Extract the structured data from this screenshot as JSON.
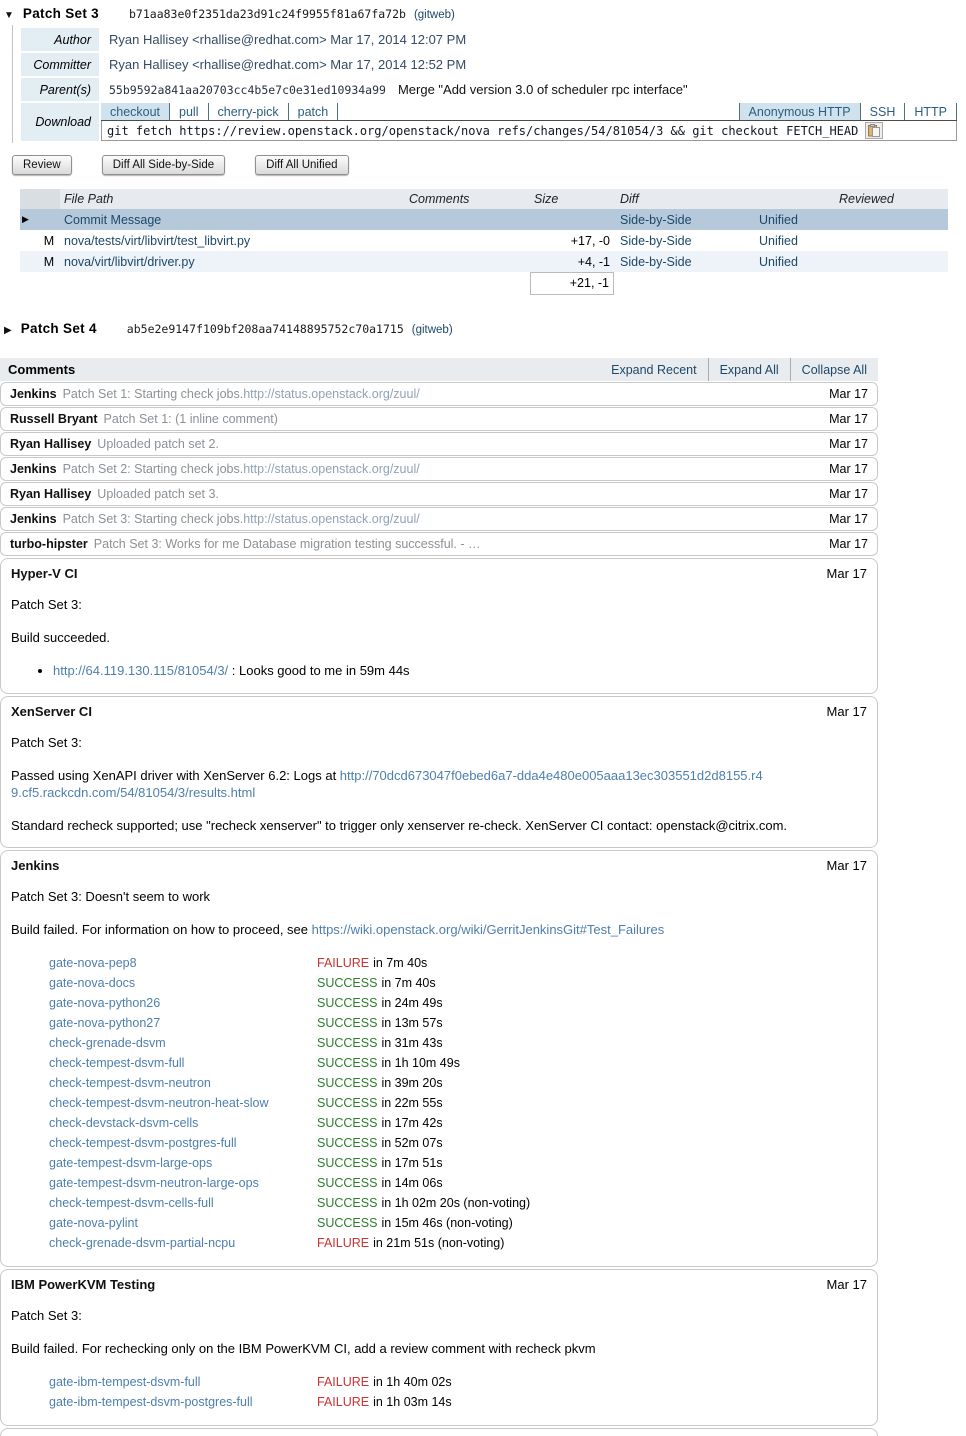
{
  "colors": {
    "success_green": "#2d7d2d",
    "failure_red": "#cc3333",
    "body_link_blue": "#4d7fae",
    "nav_link_navy": "#1d4868",
    "selected_row_bg": "#b5c9db",
    "tab_selected_bg": "#cfe2ee",
    "label_col_bg": "#e3edf4"
  },
  "icons": {
    "expanded_triangle": "▼",
    "collapsed_triangle": "▶",
    "row_pointer": "▶",
    "copy": "clipboard"
  },
  "patch_set_3": {
    "title": "Patch Set 3",
    "hash": "b71aa83e0f2351da23d91c24f9955f81a67fa72b",
    "gitweb_label": "(gitweb)",
    "info": {
      "author_label": "Author",
      "author_value": "Ryan Hallisey <rhallise@redhat.com> Mar 17, 2014 12:07 PM",
      "committer_label": "Committer",
      "committer_value": "Ryan Hallisey <rhallise@redhat.com> Mar 17, 2014 12:52 PM",
      "parents_label": "Parent(s)",
      "parents_hash": "55b9592a841aa20703cc4b5e7c0e31ed10934a99",
      "parents_subject": "Merge \"Add version 3.0 of scheduler rpc interface\"",
      "download_label": "Download",
      "scheme_tabs": [
        {
          "label": "checkout",
          "selected": true
        },
        {
          "label": "pull",
          "selected": false
        },
        {
          "label": "cherry-pick",
          "selected": false
        },
        {
          "label": "patch",
          "selected": false
        }
      ],
      "protocol_tabs": [
        {
          "label": "Anonymous HTTP",
          "selected": true
        },
        {
          "label": "SSH",
          "selected": false
        },
        {
          "label": "HTTP",
          "selected": false
        }
      ],
      "download_command": "git fetch https://review.openstack.org/openstack/nova refs/changes/54/81054/3 && git checkout FETCH_HEAD"
    },
    "buttons": [
      "Review",
      "Diff All Side-by-Side",
      "Diff All Unified"
    ],
    "file_table": {
      "headers": [
        "File Path",
        "Comments",
        "Size",
        "Diff",
        "Reviewed"
      ],
      "rows": [
        {
          "pointer": "▶",
          "status": "",
          "path": "Commit Message",
          "comments": "",
          "size": "",
          "sbs": "Side-by-Side",
          "unified": "Unified",
          "reviewed": "",
          "selected": true,
          "shade": false
        },
        {
          "pointer": "",
          "status": "M",
          "path": "nova/tests/virt/libvirt/test_libvirt.py",
          "comments": "",
          "size": "+17, -0",
          "sbs": "Side-by-Side",
          "unified": "Unified",
          "reviewed": "",
          "selected": false,
          "shade": false
        },
        {
          "pointer": "",
          "status": "M",
          "path": "nova/virt/libvirt/driver.py",
          "comments": "",
          "size": "+4, -1",
          "sbs": "Side-by-Side",
          "unified": "Unified",
          "reviewed": "",
          "selected": false,
          "shade": true
        }
      ],
      "total_size": "+21, -1"
    }
  },
  "patch_set_4": {
    "title": "Patch Set 4",
    "hash": "ab5e2e9147f109bf208aa74148895752c70a1715",
    "gitweb_label": "(gitweb)"
  },
  "comments": {
    "title": "Comments",
    "actions": [
      {
        "label": "Expand Recent",
        "first": true
      },
      {
        "label": "Expand All",
        "first": false
      },
      {
        "label": "Collapse All",
        "first": false
      }
    ],
    "collapsed": [
      {
        "author": "Jenkins",
        "summary": "Patch Set 1: Starting check jobs. ",
        "link": "http://status.openstack.org/zuul/",
        "date": "Mar 17"
      },
      {
        "author": "Russell Bryant",
        "summary": "Patch Set 1: (1 inline comment)",
        "link": "",
        "date": "Mar 17"
      },
      {
        "author": "Ryan Hallisey",
        "summary": "Uploaded patch set 2.",
        "link": "",
        "date": "Mar 17"
      },
      {
        "author": "Jenkins",
        "summary": "Patch Set 2: Starting check jobs. ",
        "link": "http://status.openstack.org/zuul/",
        "date": "Mar 17"
      },
      {
        "author": "Ryan Hallisey",
        "summary": "Uploaded patch set 3.",
        "link": "",
        "date": "Mar 17"
      },
      {
        "author": "Jenkins",
        "summary": "Patch Set 3: Starting check jobs. ",
        "link": "http://status.openstack.org/zuul/",
        "date": "Mar 17"
      },
      {
        "author": "turbo-hipster",
        "summary": "Patch Set 3: Works for me Database migration testing successful. - …",
        "link": "",
        "date": "Mar 17"
      }
    ],
    "expanded": {
      "hyperv": {
        "author": "Hyper-V CI",
        "date": "Mar 17",
        "p1": "Patch Set 3:",
        "p2": "Build succeeded.",
        "bullet_link": "http://64.119.130.115/81054/3/",
        "bullet_text": " : Looks good to me in 59m 44s"
      },
      "xenserver": {
        "author": "XenServer CI",
        "date": "Mar 17",
        "p1": "Patch Set 3:",
        "p2_prefix": "Passed using XenAPI driver with XenServer 6.2: Logs at ",
        "p2_link": "http://70dcd673047f0ebed6a7-dda4e480e005aaa13ec303551d2d8155.r49.cf5.rackcdn.com/54/81054/3/results.html",
        "p3": "Standard recheck supported; use \"recheck xenserver\" to trigger only xenserver re-check. XenServer CI contact: openstack@citrix.com."
      },
      "jenkins": {
        "author": "Jenkins",
        "date": "Mar 17",
        "p1": "Patch Set 3: Doesn't seem to work",
        "p2_prefix": "Build failed. For information on how to proceed, see ",
        "p2_link": "https://wiki.openstack.org/wiki/GerritJenkinsGit#Test_Failures",
        "tests": [
          {
            "name": "gate-nova-pep8",
            "status": "FAILURE",
            "duration": "in 7m 40s"
          },
          {
            "name": "gate-nova-docs",
            "status": "SUCCESS",
            "duration": "in 7m 40s"
          },
          {
            "name": "gate-nova-python26",
            "status": "SUCCESS",
            "duration": "in 24m 49s"
          },
          {
            "name": "gate-nova-python27",
            "status": "SUCCESS",
            "duration": "in 13m 57s"
          },
          {
            "name": "check-grenade-dsvm",
            "status": "SUCCESS",
            "duration": "in 31m 43s"
          },
          {
            "name": "check-tempest-dsvm-full",
            "status": "SUCCESS",
            "duration": "in 1h 10m 49s"
          },
          {
            "name": "check-tempest-dsvm-neutron",
            "status": "SUCCESS",
            "duration": "in 39m 20s"
          },
          {
            "name": "check-tempest-dsvm-neutron-heat-slow",
            "status": "SUCCESS",
            "duration": "in 22m 55s"
          },
          {
            "name": "check-devstack-dsvm-cells",
            "status": "SUCCESS",
            "duration": "in 17m 42s"
          },
          {
            "name": "check-tempest-dsvm-postgres-full",
            "status": "SUCCESS",
            "duration": "in 52m 07s"
          },
          {
            "name": "gate-tempest-dsvm-large-ops",
            "status": "SUCCESS",
            "duration": "in 17m 51s"
          },
          {
            "name": "gate-tempest-dsvm-neutron-large-ops",
            "status": "SUCCESS",
            "duration": "in 14m 06s"
          },
          {
            "name": "check-tempest-dsvm-cells-full",
            "status": "SUCCESS",
            "duration": "in 1h 02m 20s (non-voting)"
          },
          {
            "name": "gate-nova-pylint",
            "status": "SUCCESS",
            "duration": "in 15m 46s (non-voting)"
          },
          {
            "name": "check-grenade-dsvm-partial-ncpu",
            "status": "FAILURE",
            "duration": "in 21m 51s (non-voting)"
          }
        ]
      },
      "ibm": {
        "author": "IBM PowerKVM Testing",
        "date": "Mar 17",
        "p1": "Patch Set 3:",
        "p2": "Build failed. For rechecking only on the IBM PowerKVM CI, add a review comment with recheck pkvm",
        "tests": [
          {
            "name": "gate-ibm-tempest-dsvm-full",
            "status": "FAILURE",
            "duration": "in 1h 40m 02s"
          },
          {
            "name": "gate-ibm-tempest-dsvm-postgres-full",
            "status": "FAILURE",
            "duration": "in 1h 03m 14s"
          }
        ]
      }
    }
  }
}
